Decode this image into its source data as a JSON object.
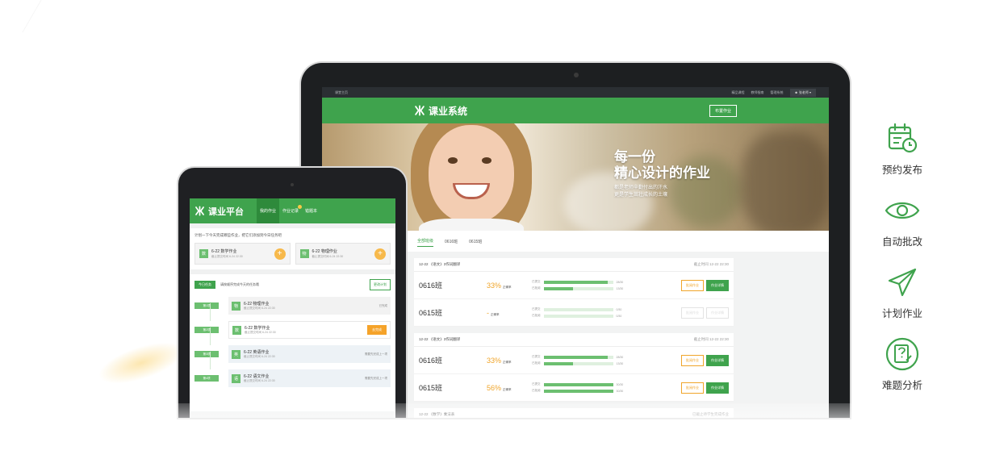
{
  "colors": {
    "brand_green": "#3fa34d",
    "accent_orange": "#f0a52a",
    "dark_frame": "#1d1f21"
  },
  "laptop": {
    "topbar": {
      "left": "课堂主页",
      "links": [
        "精品课程",
        "教师指南",
        "管理系统"
      ],
      "user": "张老师"
    },
    "app_title": "课业系统",
    "assign_button": "布置作业",
    "hero": {
      "line1": "每一份",
      "line2": "精心设计的作业",
      "sub1": "都是老师辛勤付出的汗水",
      "sub2": "更是学生茁壮成长的土壤"
    },
    "tabs": [
      "全部班级",
      "0616班",
      "0615班"
    ],
    "homeworks": [
      {
        "title": "12-22 《语文》3作词翻译",
        "deadline": "截止时间 12-22 22:30",
        "rows": [
          {
            "cls": "0616班",
            "rate": "33%",
            "rate_label": "正确率",
            "submitted_label": "已提交",
            "submitted": "28/30",
            "submitted_pct": 0.93,
            "graded_label": "已批阅",
            "graded": "13/30",
            "graded_pct": 0.43,
            "btn1": "批阅作业",
            "btn2": "作业详情",
            "disabled": false
          },
          {
            "cls": "0615班",
            "rate": "-",
            "rate_label": "正确率",
            "submitted_label": "已提交",
            "submitted": "0/30",
            "submitted_pct": 0,
            "graded_label": "已批阅",
            "graded": "0/30",
            "graded_pct": 0,
            "btn1": "批阅作业",
            "btn2": "作业详情",
            "disabled": true
          }
        ]
      },
      {
        "title": "12-22 《语文》3作词翻译",
        "deadline": "截止时间 12-22 22:30",
        "rows": [
          {
            "cls": "0616班",
            "rate": "33%",
            "rate_label": "正确率",
            "submitted_label": "已提交",
            "submitted": "28/30",
            "submitted_pct": 0.93,
            "graded_label": "已批阅",
            "graded": "13/30",
            "graded_pct": 0.43,
            "btn1": "批阅作业",
            "btn2": "作业详情",
            "disabled": false
          },
          {
            "cls": "0615班",
            "rate": "56%",
            "rate_label": "正确率",
            "submitted_label": "已提交",
            "submitted": "30/30",
            "submitted_pct": 1,
            "graded_label": "已批阅",
            "graded": "30/30",
            "graded_pct": 1,
            "btn1": "批阅作业",
            "btn2": "作业详情",
            "disabled": false
          }
        ]
      }
    ],
    "next_title": "12-22 《数学》乘法表",
    "next_status": "已截止待学生完成作业"
  },
  "tablet": {
    "app_title": "课业平台",
    "nav": [
      "我的作业",
      "作业记录",
      "错题本"
    ],
    "plan_hint": "计划一下今天完成哪些作业，把它们添加到今日任务吧",
    "plan_cards": [
      {
        "subj": "数",
        "name": "6-22 数学作业",
        "deadline": "截止提交时间 6-24 22:30"
      },
      {
        "subj": "物",
        "name": "6-22 物理作业",
        "deadline": "截止提交时间 6-24 22:30"
      }
    ],
    "today_tag": "今日任务",
    "today_msg": "请按顺序完成今天的任务哦",
    "change_plan": "更改计划",
    "tasks": [
      {
        "step": "第1项",
        "subj": "物",
        "name": "6-22 物理作业",
        "deadline": "截止提交时间 6-24 22:30",
        "status": "已完成",
        "style": "grey"
      },
      {
        "step": "第2项",
        "subj": "数",
        "name": "6-22 数学作业",
        "deadline": "截止提交时间 6-24 22:30",
        "status": "去完成",
        "style": "white"
      },
      {
        "step": "第3项",
        "subj": "英",
        "name": "6-22 英语作业",
        "deadline": "截止提交时间 6-24 22:30",
        "status": "需要先完成上一项",
        "style": "blue"
      },
      {
        "step": "第4项",
        "subj": "语",
        "name": "6-22 语文作业",
        "deadline": "截止提交时间 6-24 22:30",
        "status": "需要先完成上一项",
        "style": "blue"
      }
    ]
  },
  "features": [
    {
      "icon": "calendar-clock-icon",
      "label": "预约发布"
    },
    {
      "icon": "eye-icon",
      "label": "自动批改"
    },
    {
      "icon": "paper-plane-icon",
      "label": "计划作业"
    },
    {
      "icon": "question-doc-icon",
      "label": "难题分析"
    }
  ]
}
